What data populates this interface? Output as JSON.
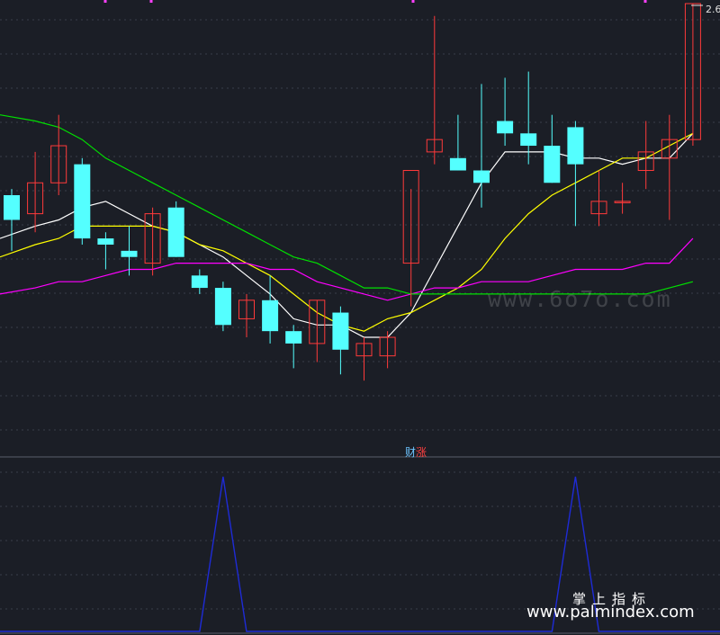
{
  "chart_data": {
    "type": "candlestick",
    "candles": [
      {
        "o": 2.29,
        "h": 2.3,
        "l": 2.2,
        "c": 2.25
      },
      {
        "o": 2.26,
        "h": 2.36,
        "l": 2.23,
        "c": 2.31
      },
      {
        "o": 2.31,
        "h": 2.42,
        "l": 2.29,
        "c": 2.37
      },
      {
        "o": 2.34,
        "h": 2.35,
        "l": 2.21,
        "c": 2.22
      },
      {
        "o": 2.22,
        "h": 2.23,
        "l": 2.17,
        "c": 2.21
      },
      {
        "o": 2.2,
        "h": 2.24,
        "l": 2.16,
        "c": 2.19
      },
      {
        "o": 2.18,
        "h": 2.27,
        "l": 2.16,
        "c": 2.26
      },
      {
        "o": 2.27,
        "h": 2.28,
        "l": 2.19,
        "c": 2.19
      },
      {
        "o": 2.16,
        "h": 2.17,
        "l": 2.13,
        "c": 2.14
      },
      {
        "o": 2.14,
        "h": 2.15,
        "l": 2.07,
        "c": 2.08
      },
      {
        "o": 2.09,
        "h": 2.13,
        "l": 2.06,
        "c": 2.12
      },
      {
        "o": 2.12,
        "h": 2.16,
        "l": 2.05,
        "c": 2.07
      },
      {
        "o": 2.07,
        "h": 2.08,
        "l": 2.01,
        "c": 2.05
      },
      {
        "o": 2.05,
        "h": 2.12,
        "l": 2.02,
        "c": 2.12
      },
      {
        "o": 2.1,
        "h": 2.11,
        "l": 2.0,
        "c": 2.04
      },
      {
        "o": 2.03,
        "h": 2.06,
        "l": 1.99,
        "c": 2.05
      },
      {
        "o": 2.03,
        "h": 2.07,
        "l": 2.01,
        "c": 2.06
      },
      {
        "o": 2.18,
        "h": 2.3,
        "l": 2.11,
        "c": 2.33
      },
      {
        "o": 2.36,
        "h": 2.58,
        "l": 2.34,
        "c": 2.38
      },
      {
        "o": 2.35,
        "h": 2.42,
        "l": 2.33,
        "c": 2.33
      },
      {
        "o": 2.33,
        "h": 2.47,
        "l": 2.27,
        "c": 2.31
      },
      {
        "o": 2.41,
        "h": 2.48,
        "l": 2.37,
        "c": 2.39
      },
      {
        "o": 2.39,
        "h": 2.49,
        "l": 2.34,
        "c": 2.37
      },
      {
        "o": 2.37,
        "h": 2.42,
        "l": 2.31,
        "c": 2.31
      },
      {
        "o": 2.4,
        "h": 2.41,
        "l": 2.24,
        "c": 2.34
      },
      {
        "o": 2.26,
        "h": 2.33,
        "l": 2.24,
        "c": 2.28
      },
      {
        "o": 2.28,
        "h": 2.31,
        "l": 2.26,
        "c": 2.28
      },
      {
        "o": 2.33,
        "h": 2.41,
        "l": 2.3,
        "c": 2.36
      },
      {
        "o": 2.35,
        "h": 2.42,
        "l": 2.25,
        "c": 2.38
      },
      {
        "o": 2.38,
        "h": 2.6,
        "l": 2.37,
        "c": 2.6
      }
    ],
    "ma": [
      {
        "color": "#ffffff",
        "values": [
          2.22,
          2.24,
          2.25,
          2.27,
          2.28,
          2.26,
          2.24,
          2.23,
          2.21,
          2.19,
          2.16,
          2.13,
          2.09,
          2.08,
          2.08,
          2.06,
          2.06,
          2.1,
          2.17,
          2.24,
          2.31,
          2.36,
          2.36,
          2.36,
          2.35,
          2.35,
          2.34,
          2.35,
          2.35,
          2.39
        ]
      },
      {
        "color": "#ffff00",
        "values": [
          2.19,
          2.21,
          2.22,
          2.24,
          2.24,
          2.24,
          2.24,
          2.23,
          2.21,
          2.2,
          2.18,
          2.16,
          2.13,
          2.1,
          2.08,
          2.07,
          2.09,
          2.1,
          2.12,
          2.14,
          2.17,
          2.22,
          2.26,
          2.29,
          2.31,
          2.33,
          2.35,
          2.35,
          2.37,
          2.39
        ]
      },
      {
        "color": "#ff00ff",
        "values": [
          2.13,
          2.14,
          2.15,
          2.15,
          2.16,
          2.17,
          2.17,
          2.18,
          2.18,
          2.18,
          2.18,
          2.17,
          2.17,
          2.15,
          2.14,
          2.13,
          2.12,
          2.13,
          2.14,
          2.14,
          2.15,
          2.15,
          2.15,
          2.16,
          2.17,
          2.17,
          2.17,
          2.18,
          2.18,
          2.22
        ]
      },
      {
        "color": "#00e000",
        "values": [
          2.42,
          2.41,
          2.4,
          2.38,
          2.35,
          2.33,
          2.31,
          2.29,
          2.27,
          2.25,
          2.23,
          2.21,
          2.19,
          2.18,
          2.16,
          2.14,
          2.14,
          2.13,
          2.13,
          2.13,
          2.13,
          2.13,
          2.13,
          2.13,
          2.13,
          2.13,
          2.13,
          2.13,
          2.14,
          2.15
        ]
      }
    ],
    "price_label": "2.6",
    "indicator_title_part1": "财",
    "indicator_title_part2": "涨",
    "indicator": {
      "color": "#1e2bd6",
      "values": [
        0,
        0,
        0,
        0,
        0,
        0,
        0,
        0,
        0,
        1,
        0,
        0,
        0,
        0,
        0,
        0,
        0,
        0,
        0,
        0,
        0,
        0,
        0,
        0,
        1,
        0,
        0,
        0,
        0,
        0
      ]
    }
  },
  "watermark": "www.6o7o.com",
  "footer": {
    "line1": "掌上指标",
    "line2": "www.palmindex.com"
  }
}
